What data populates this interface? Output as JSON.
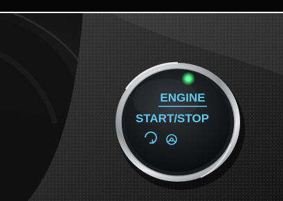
{
  "image": {
    "button": {
      "line1": "ENGINE",
      "line2": "START/STOP"
    },
    "icons": [
      "power-cycle-icon",
      "steering-wheel-icon"
    ],
    "colors": {
      "label": "#5fc8ee",
      "indicator": "#3cf07a",
      "chrome": "#c8ccd0"
    }
  }
}
